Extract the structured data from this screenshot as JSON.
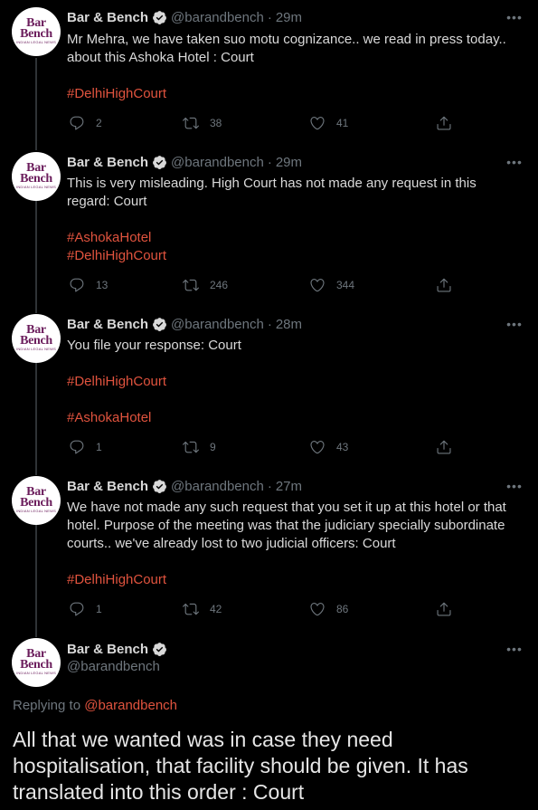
{
  "tweets": [
    {
      "name": "Bar & Bench",
      "handle": "@barandbench",
      "time": "29m",
      "text": "Mr Mehra, we have taken suo motu cognizance.. we read in press today.. about this Ashoka Hotel : Court",
      "tags": [
        "#DelhiHighCourt"
      ],
      "replies": "2",
      "retweets": "38",
      "likes": "41"
    },
    {
      "name": "Bar & Bench",
      "handle": "@barandbench",
      "time": "29m",
      "text": "This is very misleading. High Court has not made any request in this regard: Court",
      "tags": [
        "#AshokaHotel",
        "#DelhiHighCourt"
      ],
      "replies": "13",
      "retweets": "246",
      "likes": "344"
    },
    {
      "name": "Bar & Bench",
      "handle": "@barandbench",
      "time": "28m",
      "text": "You file your response: Court",
      "tags": [
        "#DelhiHighCourt",
        "#AshokaHotel"
      ],
      "replies": "1",
      "retweets": "9",
      "likes": "43"
    },
    {
      "name": "Bar & Bench",
      "handle": "@barandbench",
      "time": "27m",
      "text": "We have not made any such request that you set it up at this hotel or that hotel. Purpose of the meeting was that the judiciary specially subordinate courts.. we've already lost to two judicial officers: Court",
      "tags": [
        "#DelhiHighCourt"
      ],
      "replies": "1",
      "retweets": "42",
      "likes": "86"
    }
  ],
  "focused": {
    "name": "Bar & Bench",
    "handle": "@barandbench",
    "replying_prefix": "Replying to",
    "replying_handle": "@barandbench",
    "text": "All that we wanted was in case they need hospitalisation, that facility should be given. It has translated into this order : Court"
  },
  "avatar": {
    "line1": "Bar",
    "line2": "Bench",
    "line3": "INDIAN LEGAL NEWS"
  },
  "ui": {
    "separator": "·",
    "more": "•••"
  },
  "colors": {
    "background": "#000000",
    "hashtag": "#e0533e",
    "muted": "#6e767d",
    "verified": "#d9d9d9"
  }
}
